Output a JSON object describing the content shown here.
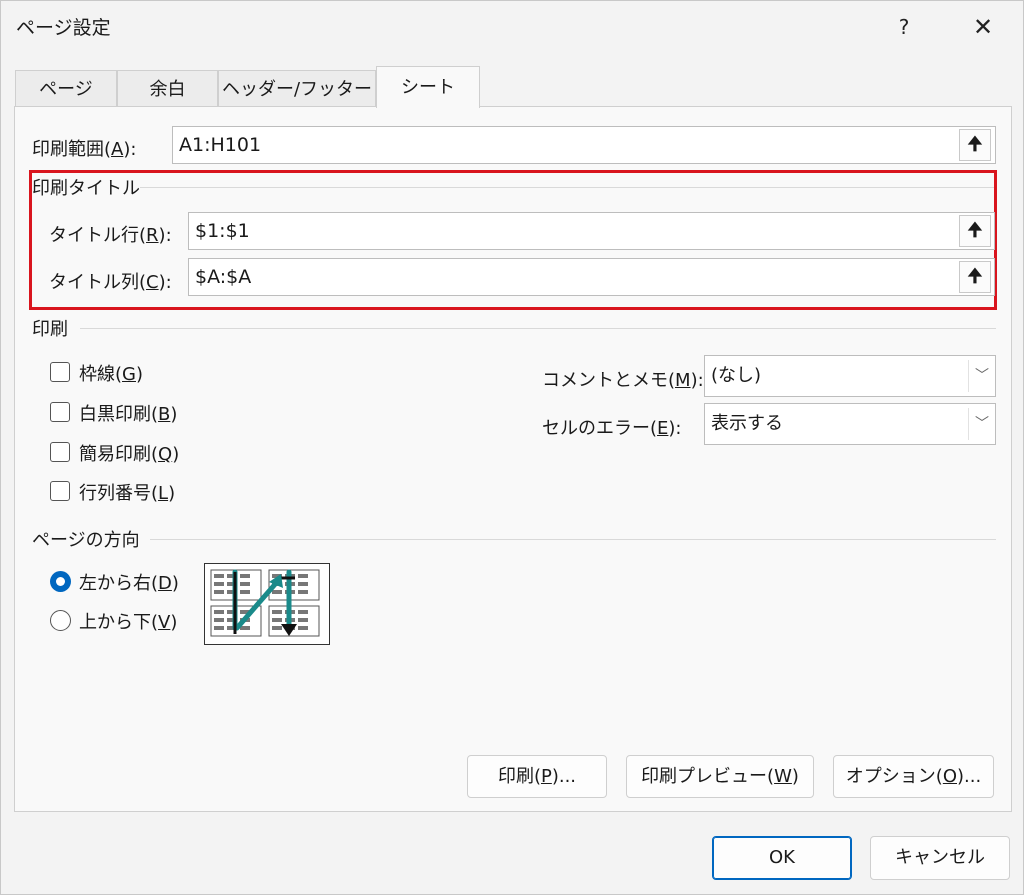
{
  "window": {
    "title": "ページ設定",
    "help": "?",
    "close": "✕"
  },
  "tabs": [
    {
      "label": "ページ",
      "active": false
    },
    {
      "label": "余白",
      "active": false
    },
    {
      "label": "ヘッダー/フッター",
      "active": false
    },
    {
      "label": "シート",
      "active": true
    }
  ],
  "print_area": {
    "label_pre": "印刷範囲(",
    "key": "A",
    "label_post": "):",
    "value": "A1:H101"
  },
  "print_titles": {
    "group_label": "印刷タイトル",
    "rows": {
      "label_pre": "タイトル行(",
      "key": "R",
      "label_post": "):",
      "value": "$1:$1"
    },
    "cols": {
      "label_pre": "タイトル列(",
      "key": "C",
      "label_post": "):",
      "value": "$A:$A"
    },
    "highlight_color": "#d9151e"
  },
  "print": {
    "group_label": "印刷",
    "gridlines": {
      "label_pre": "枠線(",
      "key": "G",
      "label_post": ")",
      "checked": false
    },
    "black_white": {
      "label_pre": "白黒印刷(",
      "key": "B",
      "label_post": ")",
      "checked": false
    },
    "draft": {
      "label_pre": "簡易印刷(",
      "key": "Q",
      "label_post": ")",
      "checked": false
    },
    "headings": {
      "label_pre": "行列番号(",
      "key": "L",
      "label_post": ")",
      "checked": false
    },
    "comments": {
      "label_pre": "コメントとメモ(",
      "key": "M",
      "label_post": "):",
      "value": "(なし)"
    },
    "errors": {
      "label_pre": "セルのエラー(",
      "key": "E",
      "label_post": "):",
      "value": "表示する"
    }
  },
  "page_order": {
    "group_label": "ページの方向",
    "left_to_right": {
      "label_pre": "左から右(",
      "key": "D",
      "label_post": ")",
      "selected": true
    },
    "top_to_bottom": {
      "label_pre": "上から下(",
      "key": "V",
      "label_post": ")",
      "selected": false
    },
    "arrow_color": "#1a8a8a"
  },
  "buttons": {
    "print": {
      "label_pre": "印刷(",
      "key": "P",
      "label_post": ")..."
    },
    "preview": {
      "label_pre": "印刷プレビュー(",
      "key": "W",
      "label_post": ")"
    },
    "options": {
      "label_pre": "オプション(",
      "key": "O",
      "label_post": ")..."
    },
    "ok": "OK",
    "cancel": "キャンセル"
  },
  "icons": {
    "collapse": "collapse-dialog-icon",
    "dropdown": "chevron-down-icon"
  },
  "colors": {
    "accent": "#0067c0"
  }
}
